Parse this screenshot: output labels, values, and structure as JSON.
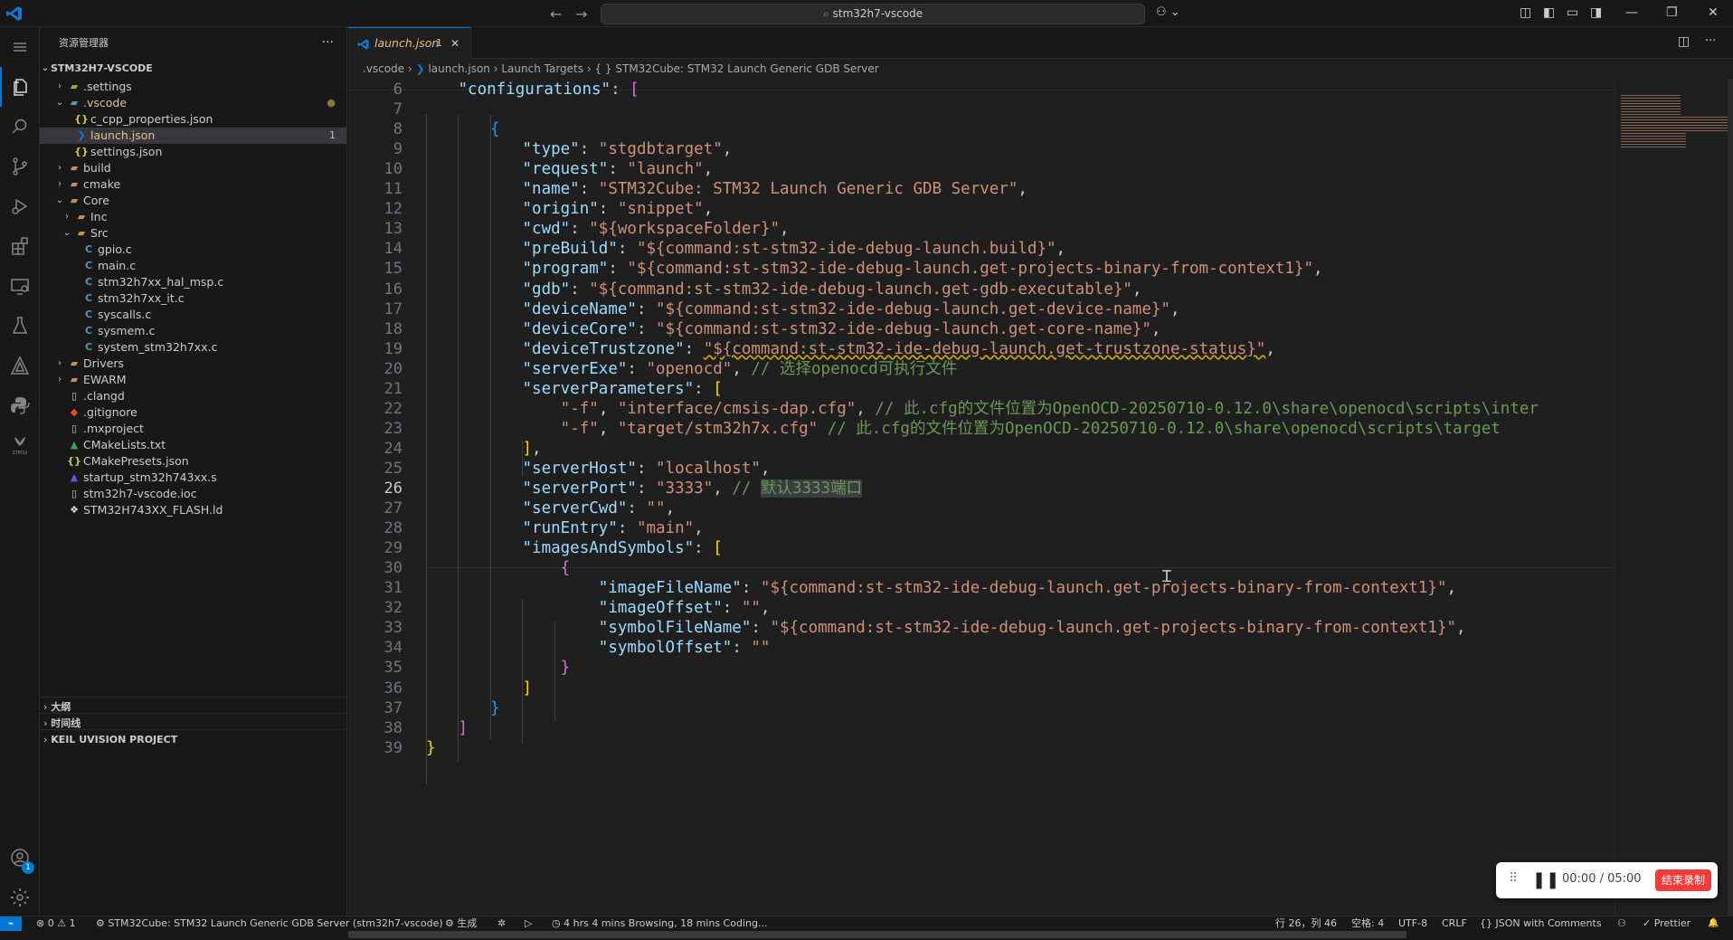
{
  "titlebar": {
    "search_text": "stm32h7-vscode",
    "back_glyph": "←",
    "forward_glyph": "→",
    "copilot_glyph": "⚇ ⌄",
    "layout_icons": [
      "◫",
      "◧",
      "▭",
      "◨"
    ],
    "window_controls": [
      "—",
      "❐",
      "✕"
    ]
  },
  "activity_bar": {
    "items": [
      "explorer-icon",
      "search-icon",
      "source-control-icon",
      "run-debug-icon",
      "extensions-icon",
      "remote-explorer-icon",
      "testing-icon",
      "cmake-icon",
      "python-icon",
      "stm32-icon"
    ],
    "bottom_items": [
      "account-icon",
      "settings-gear-icon"
    ],
    "account_badge": "1",
    "stm32_label": "STM32"
  },
  "sidebar": {
    "title": "资源管理器",
    "more": "···",
    "root": "STM32H7-VSCODE",
    "tree": [
      {
        "label": ".settings",
        "type": "folder",
        "open": false,
        "indent": 1
      },
      {
        "label": ".vscode",
        "type": "folder",
        "open": true,
        "indent": 1,
        "modified": true
      },
      {
        "label": "c_cpp_properties.json",
        "type": "json",
        "indent": 2
      },
      {
        "label": "launch.json",
        "type": "launch",
        "indent": 2,
        "selected": true,
        "badge": "1"
      },
      {
        "label": "settings.json",
        "type": "json",
        "indent": 2
      },
      {
        "label": "build",
        "type": "folder",
        "open": false,
        "indent": 1
      },
      {
        "label": "cmake",
        "type": "folder",
        "open": false,
        "indent": 1
      },
      {
        "label": "Core",
        "type": "folder",
        "open": true,
        "indent": 1
      },
      {
        "label": "Inc",
        "type": "folder",
        "open": false,
        "indent": 2
      },
      {
        "label": "Src",
        "type": "folder",
        "open": true,
        "indent": 2
      },
      {
        "label": "gpio.c",
        "type": "c",
        "indent": 3
      },
      {
        "label": "main.c",
        "type": "c",
        "indent": 3
      },
      {
        "label": "stm32h7xx_hal_msp.c",
        "type": "c",
        "indent": 3
      },
      {
        "label": "stm32h7xx_it.c",
        "type": "c",
        "indent": 3
      },
      {
        "label": "syscalls.c",
        "type": "c",
        "indent": 3
      },
      {
        "label": "sysmem.c",
        "type": "c",
        "indent": 3
      },
      {
        "label": "system_stm32h7xx.c",
        "type": "c",
        "indent": 3
      },
      {
        "label": "Drivers",
        "type": "folder",
        "open": false,
        "indent": 1
      },
      {
        "label": "EWARM",
        "type": "folder",
        "open": false,
        "indent": 1
      },
      {
        "label": ".clangd",
        "type": "file",
        "indent": 1
      },
      {
        "label": ".gitignore",
        "type": "git",
        "indent": 1
      },
      {
        "label": ".mxproject",
        "type": "file",
        "indent": 1
      },
      {
        "label": "CMakeLists.txt",
        "type": "cmake",
        "indent": 1
      },
      {
        "label": "CMakePresets.json",
        "type": "json",
        "indent": 1
      },
      {
        "label": "startup_stm32h743xx.s",
        "type": "asm",
        "indent": 1
      },
      {
        "label": "stm32h7-vscode.ioc",
        "type": "file",
        "indent": 1
      },
      {
        "label": "STM32H743XX_FLASH.ld",
        "type": "ld",
        "indent": 1
      }
    ],
    "panels": [
      "大纲",
      "时间线",
      "KEIL UVISION PROJECT"
    ]
  },
  "editor": {
    "tab_label": "launch.json",
    "tab_badge": "1",
    "tab_close": "✕",
    "split_icons": [
      "◫",
      "···"
    ],
    "breadcrumbs": [
      ".vscode",
      "launch.json",
      "Launch Targets",
      "{ } STM32Cube: STM32 Launch Generic GDB Server"
    ],
    "line_numbers": [
      "6",
      "7",
      "8",
      "9",
      "10",
      "11",
      "12",
      "13",
      "14",
      "15",
      "16",
      "17",
      "18",
      "19",
      "20",
      "21",
      "22",
      "23",
      "24",
      "25",
      "26",
      "27",
      "28",
      "29",
      "30",
      "31",
      "32",
      "33",
      "34",
      "35",
      "36",
      "37",
      "38",
      "39"
    ],
    "current_line": "26",
    "lines": [
      [
        {
          "t": "\"configurations\"",
          "c": "k"
        },
        {
          "t": ": ",
          "c": "p"
        },
        {
          "t": "[",
          "c": "b2"
        }
      ],
      [],
      [
        {
          "t": "{",
          "c": "b3"
        }
      ],
      [
        {
          "t": "\"type\"",
          "c": "k"
        },
        {
          "t": ": ",
          "c": "p"
        },
        {
          "t": "\"stgdbtarget\"",
          "c": "s"
        },
        {
          "t": ",",
          "c": "p"
        }
      ],
      [
        {
          "t": "\"request\"",
          "c": "k"
        },
        {
          "t": ": ",
          "c": "p"
        },
        {
          "t": "\"launch\"",
          "c": "s"
        },
        {
          "t": ",",
          "c": "p"
        }
      ],
      [
        {
          "t": "\"name\"",
          "c": "k"
        },
        {
          "t": ": ",
          "c": "p"
        },
        {
          "t": "\"STM32Cube: STM32 Launch Generic GDB Server\"",
          "c": "s"
        },
        {
          "t": ",",
          "c": "p"
        }
      ],
      [
        {
          "t": "\"origin\"",
          "c": "k"
        },
        {
          "t": ": ",
          "c": "p"
        },
        {
          "t": "\"snippet\"",
          "c": "s"
        },
        {
          "t": ",",
          "c": "p"
        }
      ],
      [
        {
          "t": "\"cwd\"",
          "c": "k"
        },
        {
          "t": ": ",
          "c": "p"
        },
        {
          "t": "\"${workspaceFolder}\"",
          "c": "s"
        },
        {
          "t": ",",
          "c": "p"
        }
      ],
      [
        {
          "t": "\"preBuild\"",
          "c": "k"
        },
        {
          "t": ": ",
          "c": "p"
        },
        {
          "t": "\"${command:st-stm32-ide-debug-launch.build}\"",
          "c": "s"
        },
        {
          "t": ",",
          "c": "p"
        }
      ],
      [
        {
          "t": "\"program\"",
          "c": "k"
        },
        {
          "t": ": ",
          "c": "p"
        },
        {
          "t": "\"${command:st-stm32-ide-debug-launch.get-projects-binary-from-context1}\"",
          "c": "s"
        },
        {
          "t": ",",
          "c": "p"
        }
      ],
      [
        {
          "t": "\"gdb\"",
          "c": "k"
        },
        {
          "t": ": ",
          "c": "p"
        },
        {
          "t": "\"${command:st-stm32-ide-debug-launch.get-gdb-executable}\"",
          "c": "s"
        },
        {
          "t": ",",
          "c": "p"
        }
      ],
      [
        {
          "t": "\"deviceName\"",
          "c": "k"
        },
        {
          "t": ": ",
          "c": "p"
        },
        {
          "t": "\"${command:st-stm32-ide-debug-launch.get-device-name}\"",
          "c": "s"
        },
        {
          "t": ",",
          "c": "p"
        }
      ],
      [
        {
          "t": "\"deviceCore\"",
          "c": "k"
        },
        {
          "t": ": ",
          "c": "p"
        },
        {
          "t": "\"${command:st-stm32-ide-debug-launch.get-core-name}\"",
          "c": "s"
        },
        {
          "t": ",",
          "c": "p"
        }
      ],
      [
        {
          "t": "\"deviceTrustzone\"",
          "c": "k"
        },
        {
          "t": ": ",
          "c": "p"
        },
        {
          "t": "\"${command:st-stm32-ide-debug-launch.get-trustzone-status}\"",
          "c": "s",
          "w": 1
        },
        {
          "t": ",",
          "c": "p"
        }
      ],
      [
        {
          "t": "\"serverExe\"",
          "c": "k"
        },
        {
          "t": ": ",
          "c": "p"
        },
        {
          "t": "\"openocd\"",
          "c": "s"
        },
        {
          "t": ", ",
          "c": "p"
        },
        {
          "t": "// 选择openocd可执行文件",
          "c": "c"
        }
      ],
      [
        {
          "t": "\"serverParameters\"",
          "c": "k"
        },
        {
          "t": ": ",
          "c": "p"
        },
        {
          "t": "[",
          "c": "b1"
        }
      ],
      [
        {
          "t": "    ",
          "c": "p"
        },
        {
          "t": "\"-f\"",
          "c": "s"
        },
        {
          "t": ", ",
          "c": "p"
        },
        {
          "t": "\"interface/cmsis-dap.cfg\"",
          "c": "s"
        },
        {
          "t": ", ",
          "c": "p"
        },
        {
          "t": "// 此.cfg的文件位置为OpenOCD-20250710-0.12.0\\share\\openocd\\scripts\\inter",
          "c": "c"
        }
      ],
      [
        {
          "t": "    ",
          "c": "p"
        },
        {
          "t": "\"-f\"",
          "c": "s"
        },
        {
          "t": ", ",
          "c": "p"
        },
        {
          "t": "\"target/stm32h7x.cfg\"",
          "c": "s"
        },
        {
          "t": " ",
          "c": "p"
        },
        {
          "t": "// 此.cfg的文件位置为OpenOCD-20250710-0.12.0\\share\\openocd\\scripts\\target",
          "c": "c"
        }
      ],
      [
        {
          "t": "]",
          "c": "b1"
        },
        {
          "t": ",",
          "c": "p"
        }
      ],
      [
        {
          "t": "\"serverHost\"",
          "c": "k"
        },
        {
          "t": ": ",
          "c": "p"
        },
        {
          "t": "\"localhost\"",
          "c": "s"
        },
        {
          "t": ",",
          "c": "p"
        }
      ],
      [
        {
          "t": "\"serverPort\"",
          "c": "k"
        },
        {
          "t": ": ",
          "c": "p"
        },
        {
          "t": "\"3333\"",
          "c": "s"
        },
        {
          "t": ", ",
          "c": "p"
        },
        {
          "t": "// ",
          "c": "c"
        },
        {
          "t": "默认3333端口",
          "c": "c",
          "h": 1
        }
      ],
      [
        {
          "t": "\"serverCwd\"",
          "c": "k"
        },
        {
          "t": ": ",
          "c": "p"
        },
        {
          "t": "\"\"",
          "c": "s"
        },
        {
          "t": ",",
          "c": "p"
        }
      ],
      [
        {
          "t": "\"runEntry\"",
          "c": "k"
        },
        {
          "t": ": ",
          "c": "p"
        },
        {
          "t": "\"main\"",
          "c": "s"
        },
        {
          "t": ",",
          "c": "p"
        }
      ],
      [
        {
          "t": "\"imagesAndSymbols\"",
          "c": "k"
        },
        {
          "t": ": ",
          "c": "p"
        },
        {
          "t": "[",
          "c": "b1"
        }
      ],
      [
        {
          "t": "    ",
          "c": "p"
        },
        {
          "t": "{",
          "c": "b2"
        }
      ],
      [
        {
          "t": "        ",
          "c": "p"
        },
        {
          "t": "\"imageFileName\"",
          "c": "k"
        },
        {
          "t": ": ",
          "c": "p"
        },
        {
          "t": "\"${command:st-stm32-ide-debug-launch.get-projects-binary-from-context1}\"",
          "c": "s"
        },
        {
          "t": ",",
          "c": "p"
        }
      ],
      [
        {
          "t": "        ",
          "c": "p"
        },
        {
          "t": "\"imageOffset\"",
          "c": "k"
        },
        {
          "t": ": ",
          "c": "p"
        },
        {
          "t": "\"\"",
          "c": "s"
        },
        {
          "t": ",",
          "c": "p"
        }
      ],
      [
        {
          "t": "        ",
          "c": "p"
        },
        {
          "t": "\"symbolFileName\"",
          "c": "k"
        },
        {
          "t": ": ",
          "c": "p"
        },
        {
          "t": "\"${command:st-stm32-ide-debug-launch.get-projects-binary-from-context1}\"",
          "c": "s"
        },
        {
          "t": ",",
          "c": "p"
        }
      ],
      [
        {
          "t": "        ",
          "c": "p"
        },
        {
          "t": "\"symbolOffset\"",
          "c": "k"
        },
        {
          "t": ": ",
          "c": "p"
        },
        {
          "t": "\"\"",
          "c": "s"
        }
      ],
      [
        {
          "t": "    ",
          "c": "p"
        },
        {
          "t": "}",
          "c": "b2"
        }
      ],
      [
        {
          "t": "]",
          "c": "b1"
        }
      ],
      [
        {
          "t": "}",
          "c": "b3"
        }
      ],
      [
        {
          "t": "]",
          "c": "b2"
        }
      ],
      [
        {
          "t": "}",
          "c": "b1"
        }
      ]
    ]
  },
  "statusbar": {
    "remote": "⌁",
    "problems": "⊗ 0 ⚠ 1",
    "debug_target": "STM32Cube: STM32 Launch Generic GDB Server (stm32h7-vscode)",
    "build": "⚙ 生成",
    "bug": "✲",
    "run": "▷",
    "wakatime": "4 hrs 4 mins Browsing, 18 mins Coding...",
    "position": "行 26，列 46",
    "spaces": "空格: 4",
    "encoding": "UTF-8",
    "eol": "CRLF",
    "language": "{} JSON with Comments",
    "copilot": "⚇",
    "prettier": "✓ Prettier",
    "bell": "🔔"
  },
  "recorder": {
    "drag": "⠿",
    "pause": "❚❚",
    "time": "00:00 / 05:00",
    "stop_label": "结束录制"
  },
  "colors": {
    "accent": "#0078d4",
    "key": "#9cdcfe",
    "string": "#ce9178",
    "comment": "#6a9955",
    "stop": "#f23b3b"
  }
}
